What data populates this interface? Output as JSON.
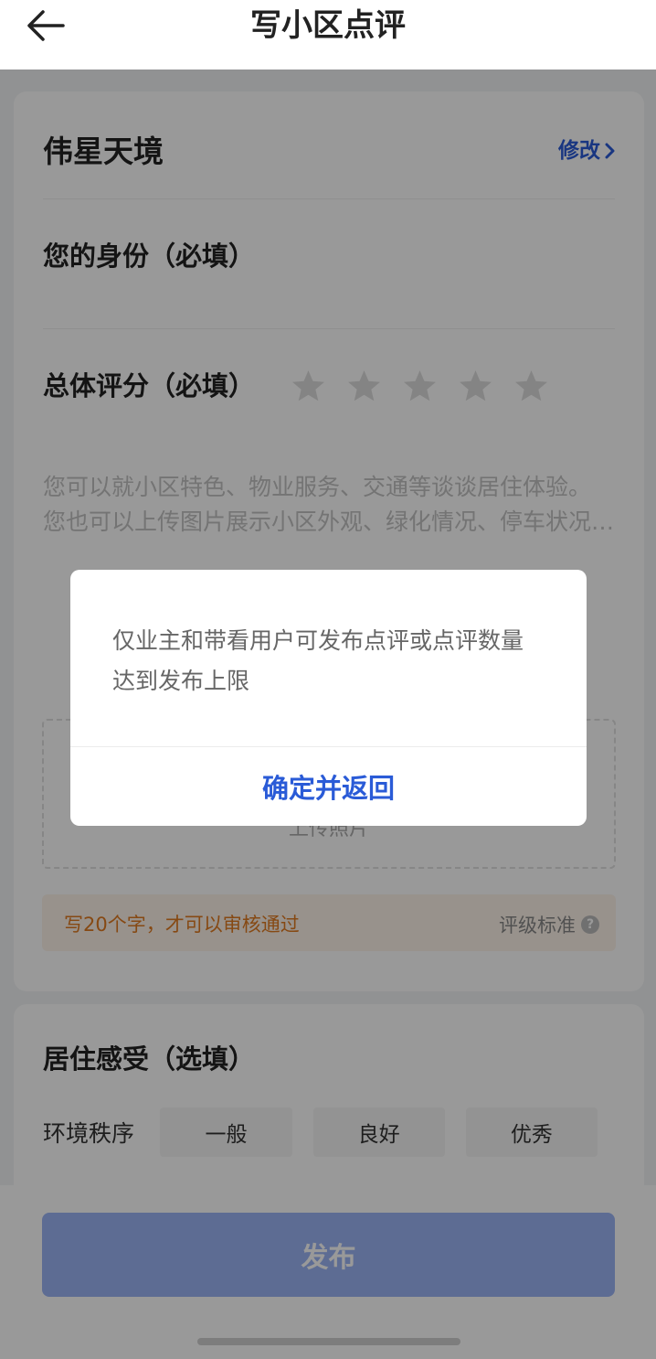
{
  "header": {
    "title": "写小区点评"
  },
  "community": {
    "name": "伟星天境",
    "edit_label": "修改"
  },
  "identity": {
    "label": "您的身份（必填）"
  },
  "rating": {
    "label": "总体评分（必填）",
    "stars": 5,
    "selected": 0
  },
  "review": {
    "placeholder_line1": "您可以就小区特色、物业服务、交通等谈谈居住体验。",
    "placeholder_line2": "您也可以上传图片展示小区外观、绿化情况、停车状况…"
  },
  "upload": {
    "label": "上传照片"
  },
  "tip": {
    "text": "写20个字，才可以审核通过",
    "standard_label": "评级标准"
  },
  "living": {
    "title": "居住感受（选填）",
    "env_label": "环境秩序",
    "options": [
      "一般",
      "良好",
      "优秀"
    ]
  },
  "publish": {
    "label": "发布"
  },
  "dialog": {
    "message": "仅业主和带看用户可发布点评或点评数量达到发布上限",
    "confirm_label": "确定并返回"
  },
  "colors": {
    "accent": "#2a5bd7",
    "tip": "#e07a20",
    "publish_bg": "#9cb4f6"
  }
}
